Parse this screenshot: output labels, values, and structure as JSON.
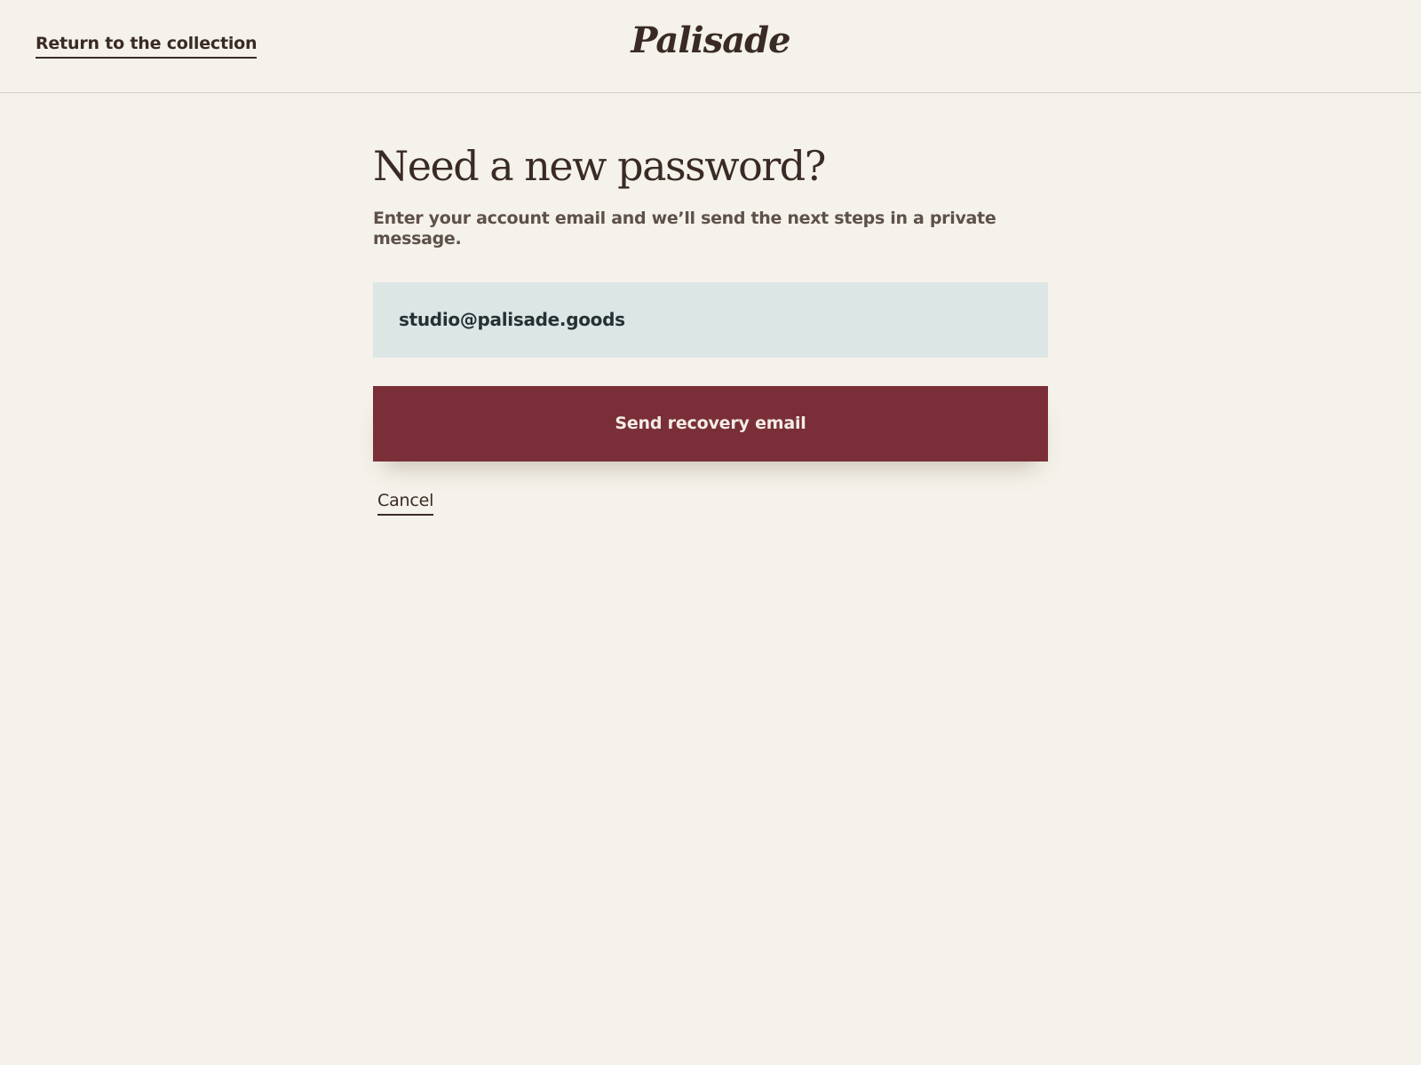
{
  "header": {
    "back_link_label": "Return to the collection",
    "brand_name": "Palisade"
  },
  "main": {
    "title": "Need a new password?",
    "subtitle": "Enter your account email and we’ll send the next steps in a private message.",
    "email_input": {
      "value": "studio@palisade.goods",
      "placeholder": ""
    },
    "submit_label": "Send recovery email",
    "cancel_label": "Cancel"
  },
  "colors": {
    "background": "#f4f2ea",
    "text": "#3a2a26",
    "muted_text": "#5e504b",
    "input_background": "#dce6e5",
    "primary_button": "#7a2f38",
    "primary_button_text": "#f4ece6"
  }
}
